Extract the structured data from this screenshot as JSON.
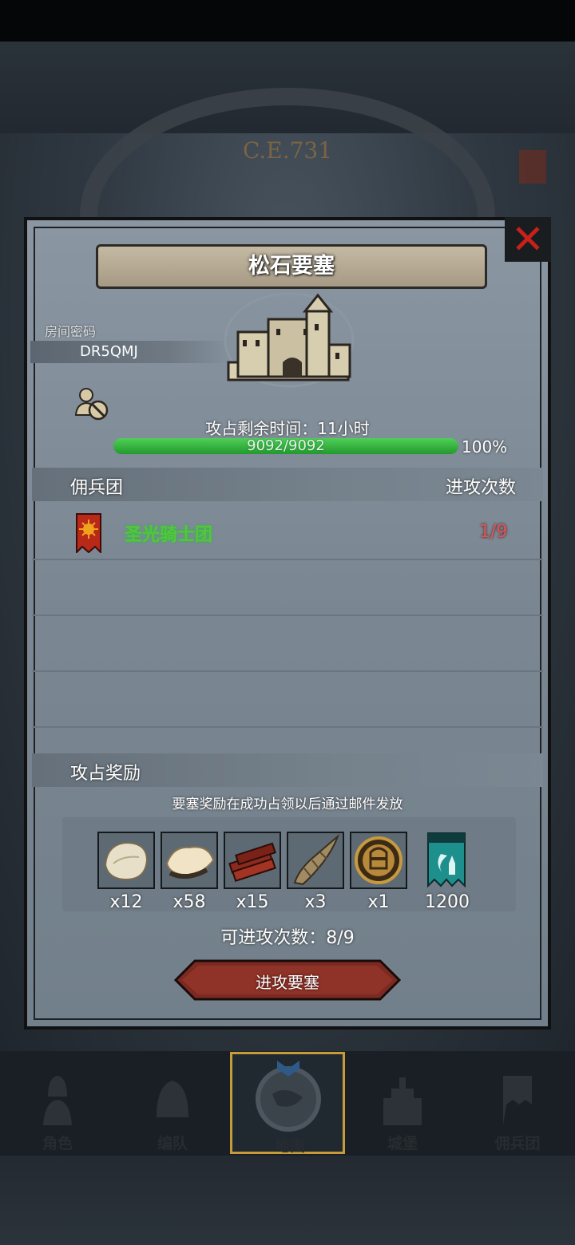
{
  "background": {
    "year": "C.E.731"
  },
  "dialog": {
    "title": "松石要塞",
    "room_label": "房间密码",
    "room_code": "DR5QMJ",
    "remaining_time": "攻占剩余时间：11小时",
    "hp_text": "9092/9092",
    "hp_percent": "100%",
    "hp_fraction": 1.0,
    "mercenary_header": "佣兵团",
    "attack_times_header": "进攻次数",
    "guilds": [
      {
        "name": "圣光骑士团",
        "count": "1/9"
      }
    ],
    "reward_header": "攻占奖励",
    "reward_note": "要塞奖励在成功占领以后通过邮件发放",
    "rewards": [
      {
        "icon": "fur-pelt-icon",
        "qty": "x12"
      },
      {
        "icon": "wool-fleece-icon",
        "qty": "x58"
      },
      {
        "icon": "wood-planks-icon",
        "qty": "x15"
      },
      {
        "icon": "horn-icon",
        "qty": "x3"
      },
      {
        "icon": "knight-helmet-medal-icon",
        "qty": "x1"
      },
      {
        "icon": "teal-banner-icon",
        "qty": "1200"
      }
    ],
    "available_attacks": "可进攻次数：8/9",
    "attack_button": "进攻要塞"
  },
  "nav": [
    {
      "label": "角色"
    },
    {
      "label": "编队"
    },
    {
      "label": "地图"
    },
    {
      "label": "城堡"
    },
    {
      "label": "佣兵团"
    }
  ],
  "colors": {
    "guild_name": "#58c43c",
    "attack_count": "#d95a4e",
    "hp_green": "#3bbf45",
    "close_red": "#c8201a",
    "nav_active_border": "#c79c38"
  }
}
